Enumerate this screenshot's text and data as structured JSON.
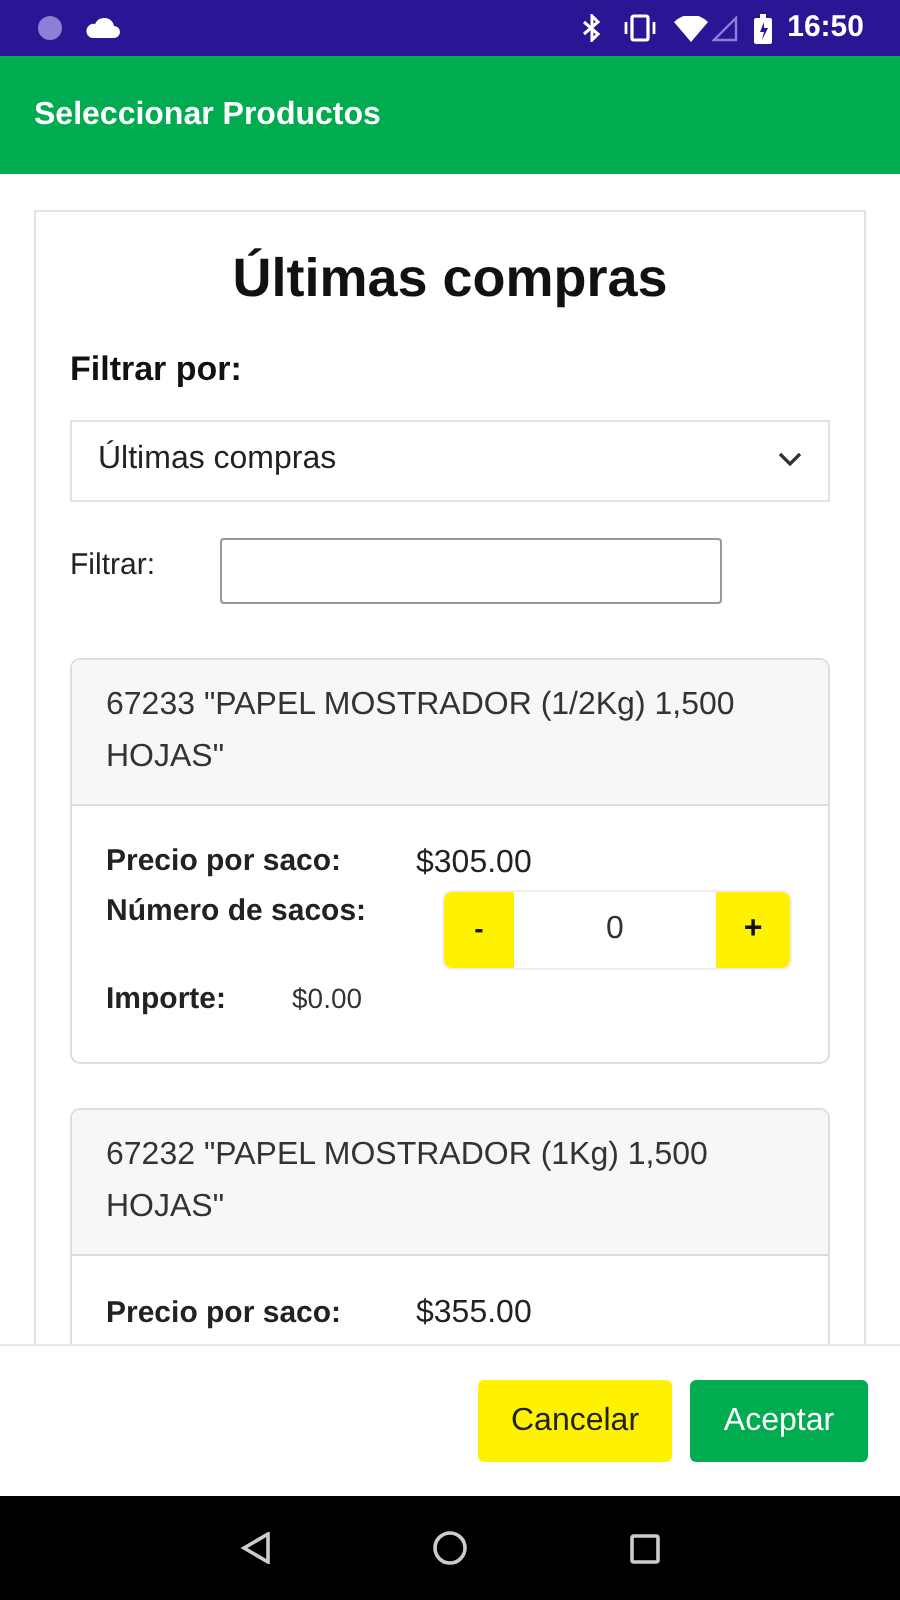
{
  "status_bar": {
    "time": "16:50"
  },
  "app_bar": {
    "title": "Seleccionar Productos"
  },
  "heading": "Últimas compras",
  "filter_by": {
    "label": "Filtrar por:",
    "value": "Últimas compras"
  },
  "filter": {
    "label": "Filtrar:"
  },
  "products": [
    {
      "name": "67233 \"PAPEL MOSTRADOR (1/2Kg) 1,500 HOJAS\"",
      "price_label": "Precio por saco:",
      "price": "$305.00",
      "quantity_label": "Número de sacos:",
      "minus": "-",
      "quantity": "0",
      "plus": "+",
      "amount_label": "Importe:",
      "amount": "$0.00"
    },
    {
      "name": "67232 \"PAPEL MOSTRADOR (1Kg) 1,500 HOJAS\"",
      "price_label": "Precio por saco:",
      "price": "$355.00"
    }
  ],
  "buttons": [
    {
      "kind": "cancel",
      "label": "Cancelar"
    },
    {
      "kind": "accept",
      "label": "Aceptar"
    }
  ]
}
